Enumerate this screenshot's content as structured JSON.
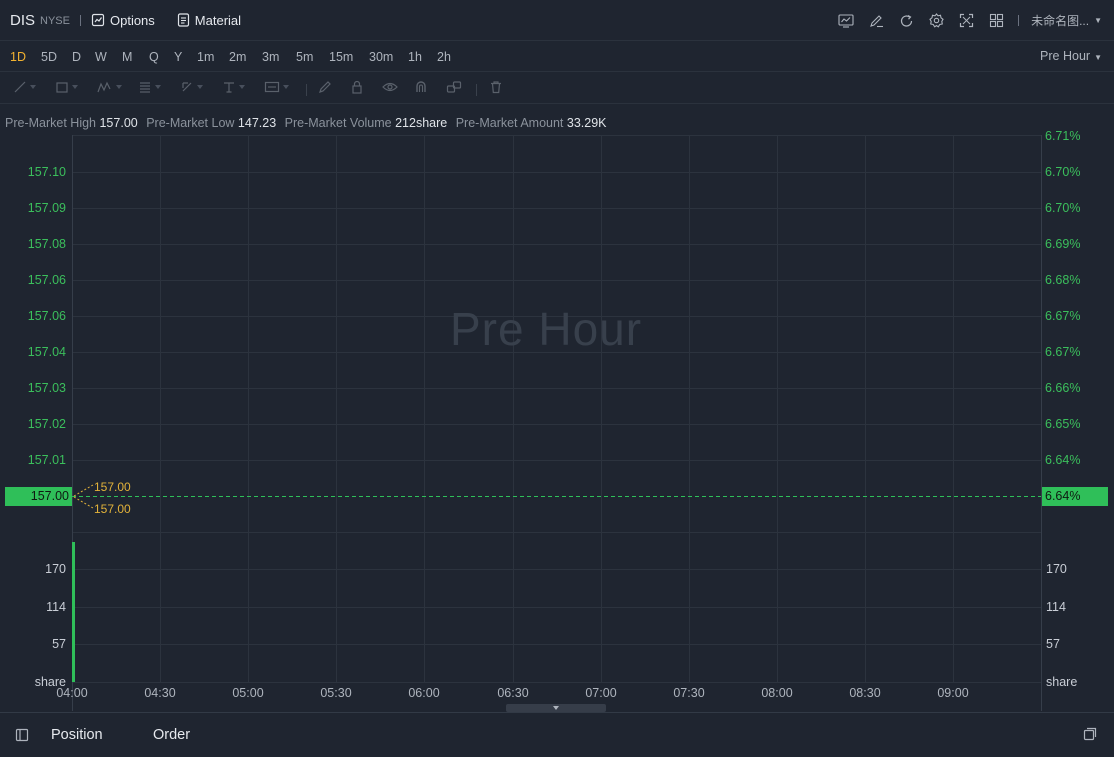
{
  "header": {
    "symbol": "DIS",
    "exchange": "NYSE",
    "options_label": "Options",
    "material_label": "Material",
    "layout_name": "未命名图...",
    "right_icons": [
      "indicator-icon",
      "draw-icon",
      "refresh-icon",
      "settings-icon",
      "fullscreen-icon",
      "layout-grid-icon"
    ]
  },
  "periods": [
    "1D",
    "5D",
    "D",
    "W",
    "M",
    "Q",
    "Y",
    "1m",
    "2m",
    "3m",
    "5m",
    "15m",
    "30m",
    "1h",
    "2h"
  ],
  "active_period": "1D",
  "session_dropdown": "Pre Hour",
  "drawing_tools": [
    "line-tool-icon",
    "rectangle-tool-icon",
    "pattern-tool-icon",
    "fib-tool-icon",
    "arrow-tool-icon",
    "text-tool-icon",
    "annotation-tool-icon",
    "pen-icon",
    "lock-icon",
    "eye-icon",
    "magnet-icon",
    "link-icon",
    "trash-icon"
  ],
  "stats": {
    "high_label": "Pre-Market High",
    "high_value": "157.00",
    "low_label": "Pre-Market Low",
    "low_value": "147.23",
    "volume_label": "Pre-Market Volume",
    "volume_value": "212share",
    "amount_label": "Pre-Market Amount",
    "amount_value": "33.29K"
  },
  "chart": {
    "watermark": "Pre Hour",
    "price_axis_left": [
      "157.10",
      "157.09",
      "157.08",
      "157.06",
      "157.06",
      "157.04",
      "157.03",
      "157.02",
      "157.01"
    ],
    "percent_axis_right": [
      "6.71%",
      "6.70%",
      "6.70%",
      "6.69%",
      "6.68%",
      "6.67%",
      "6.67%",
      "6.66%",
      "6.65%",
      "6.64%"
    ],
    "current_price": "157.00",
    "current_percent": "6.64%",
    "high_marker": "157.00",
    "low_marker": "157.00",
    "volume_axis": [
      "170",
      "114",
      "57",
      "share"
    ],
    "time_axis": [
      "04:00",
      "04:30",
      "05:00",
      "05:30",
      "06:00",
      "06:30",
      "07:00",
      "07:30",
      "08:00",
      "08:30",
      "09:00"
    ],
    "up_color": "#2fbf59",
    "marker_color": "#e2b23a"
  },
  "chart_data": {
    "type": "line",
    "x": [
      "04:00"
    ],
    "series": [
      {
        "values": [
          157.0
        ]
      }
    ],
    "volume": {
      "x": [
        "04:00"
      ],
      "values": [
        212
      ]
    },
    "ylim": [
      157.0,
      157.1
    ],
    "volume_ylim": [
      0,
      212
    ],
    "grid": true
  },
  "bottom": {
    "tabs": [
      "Position",
      "Order"
    ]
  }
}
